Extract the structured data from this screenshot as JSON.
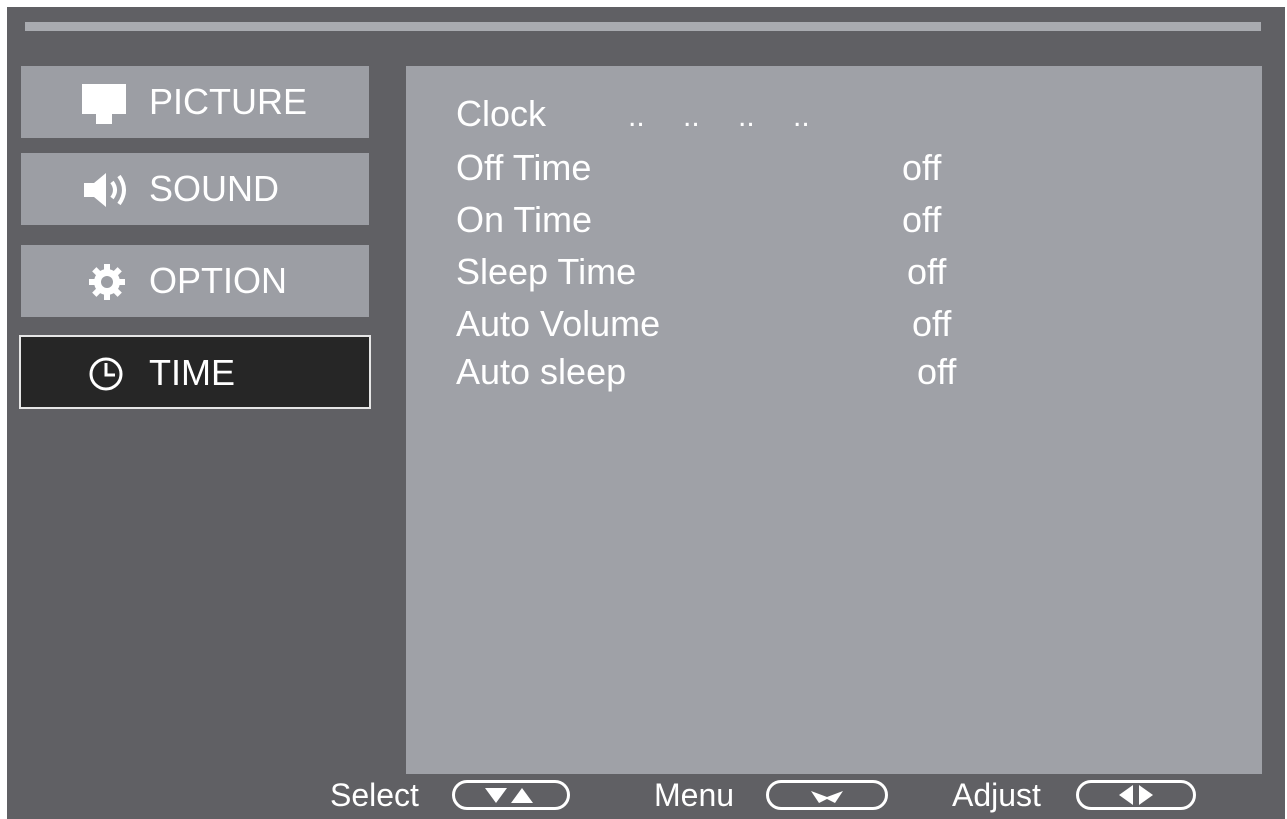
{
  "sidebar": {
    "items": [
      {
        "label": "PICTURE",
        "icon": "monitor-icon",
        "active": false
      },
      {
        "label": "SOUND",
        "icon": "speaker-icon",
        "active": false
      },
      {
        "label": "OPTION",
        "icon": "gear-icon",
        "active": false
      },
      {
        "label": "TIME",
        "icon": "clock-icon",
        "active": true
      }
    ]
  },
  "time_menu": {
    "clock": {
      "label": "Clock",
      "value": ".. .. .. .."
    },
    "rows": [
      {
        "label": "Off Time",
        "value": "off"
      },
      {
        "label": "On Time",
        "value": "off"
      },
      {
        "label": "Sleep Time",
        "value": "off"
      },
      {
        "label": "Auto Volume",
        "value": "off"
      },
      {
        "label": "Auto sleep",
        "value": "off"
      }
    ]
  },
  "footer": {
    "select_label": "Select",
    "select_icon": "up-down-arrows-icon",
    "menu_label": "Menu",
    "menu_icon": "return-arrow-icon",
    "adjust_label": "Adjust",
    "adjust_icon": "left-right-arrows-icon"
  },
  "colors": {
    "background": "#606064",
    "panel": "#9fa1a7",
    "nav_item": "#9c9ea4",
    "nav_active": "#262626",
    "text": "#ffffff"
  }
}
